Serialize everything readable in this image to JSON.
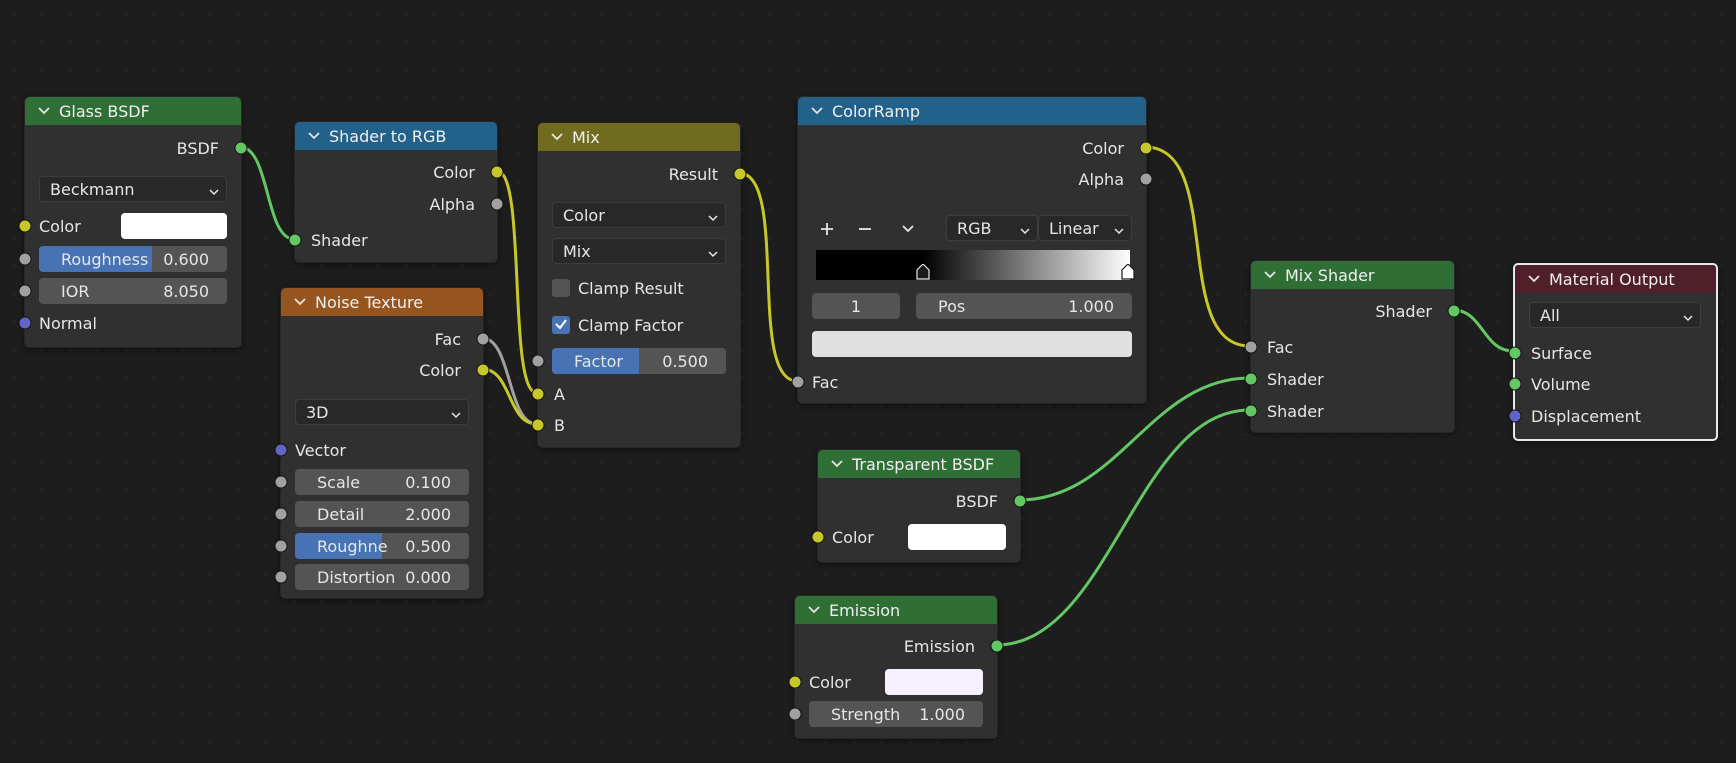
{
  "glass_bsdf": {
    "title": "Glass BSDF",
    "out_bsdf": "BSDF",
    "distribution": "Beckmann",
    "color_label": "Color",
    "roughness_label": "Roughness",
    "roughness_value": "0.600",
    "ior_label": "IOR",
    "ior_value": "8.050",
    "normal_label": "Normal"
  },
  "shader_to_rgb": {
    "title": "Shader to RGB",
    "out_color": "Color",
    "out_alpha": "Alpha",
    "in_shader": "Shader"
  },
  "noise_texture": {
    "title": "Noise Texture",
    "out_fac": "Fac",
    "out_color": "Color",
    "dimensions": "3D",
    "vector_label": "Vector",
    "scale_label": "Scale",
    "scale_value": "0.100",
    "detail_label": "Detail",
    "detail_value": "2.000",
    "roughness_label": "Roughne",
    "roughness_value": "0.500",
    "distortion_label": "Distortion",
    "distortion_value": "0.000"
  },
  "mix": {
    "title": "Mix",
    "out_result": "Result",
    "data_type": "Color",
    "blend_mode": "Mix",
    "clamp_result_label": "Clamp Result",
    "clamp_result_checked": false,
    "clamp_factor_label": "Clamp Factor",
    "clamp_factor_checked": true,
    "factor_label": "Factor",
    "factor_value": "0.500",
    "in_a": "A",
    "in_b": "B"
  },
  "color_ramp": {
    "title": "ColorRamp",
    "out_color": "Color",
    "out_alpha": "Alpha",
    "color_mode": "RGB",
    "interpolation": "Linear",
    "active_index": "1",
    "pos_label": "Pos",
    "pos_value": "1.000",
    "in_fac": "Fac"
  },
  "transparent_bsdf": {
    "title": "Transparent BSDF",
    "out_bsdf": "BSDF",
    "color_label": "Color"
  },
  "emission": {
    "title": "Emission",
    "out_emission": "Emission",
    "color_label": "Color",
    "strength_label": "Strength",
    "strength_value": "1.000"
  },
  "mix_shader": {
    "title": "Mix Shader",
    "out_shader": "Shader",
    "in_fac": "Fac",
    "in_shader_1": "Shader",
    "in_shader_2": "Shader"
  },
  "material_output": {
    "title": "Material Output",
    "target": "All",
    "in_surface": "Surface",
    "in_volume": "Volume",
    "in_displacement": "Displacement"
  },
  "colors": {
    "shader_socket": "#63c763",
    "color_socket": "#c7c729",
    "float_socket": "#a1a1a1",
    "vector_socket": "#6363c7",
    "active_field": "#4772b3"
  }
}
